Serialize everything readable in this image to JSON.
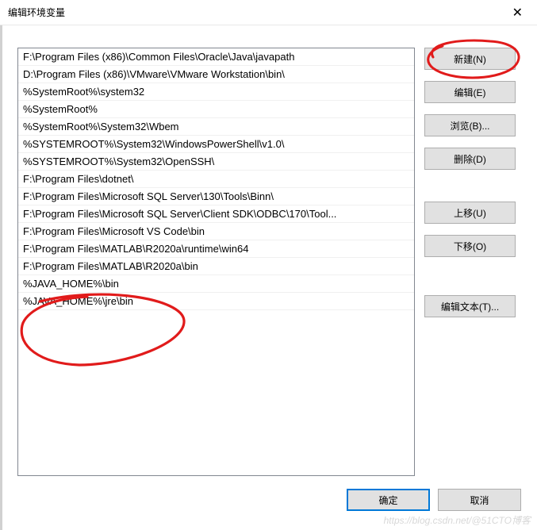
{
  "window": {
    "title": "编辑环境变量"
  },
  "list": {
    "items": [
      "F:\\Program Files (x86)\\Common Files\\Oracle\\Java\\javapath",
      "D:\\Program Files (x86)\\VMware\\VMware Workstation\\bin\\",
      "%SystemRoot%\\system32",
      "%SystemRoot%",
      "%SystemRoot%\\System32\\Wbem",
      "%SYSTEMROOT%\\System32\\WindowsPowerShell\\v1.0\\",
      "%SYSTEMROOT%\\System32\\OpenSSH\\",
      "F:\\Program Files\\dotnet\\",
      "F:\\Program Files\\Microsoft SQL Server\\130\\Tools\\Binn\\",
      "F:\\Program Files\\Microsoft SQL Server\\Client SDK\\ODBC\\170\\Tool...",
      "F:\\Program Files\\Microsoft VS Code\\bin",
      "F:\\Program Files\\MATLAB\\R2020a\\runtime\\win64",
      "F:\\Program Files\\MATLAB\\R2020a\\bin",
      "%JAVA_HOME%\\bin",
      "%JAVA_HOME%\\jre\\bin"
    ]
  },
  "buttons": {
    "new": "新建(N)",
    "edit": "编辑(E)",
    "browse": "浏览(B)...",
    "delete": "删除(D)",
    "moveUp": "上移(U)",
    "moveDown": "下移(O)",
    "editText": "编辑文本(T)...",
    "ok": "确定",
    "cancel": "取消"
  },
  "annotations": {
    "color": "#e11b1b"
  },
  "watermark": "https://blog.csdn.net/@51CTO博客"
}
